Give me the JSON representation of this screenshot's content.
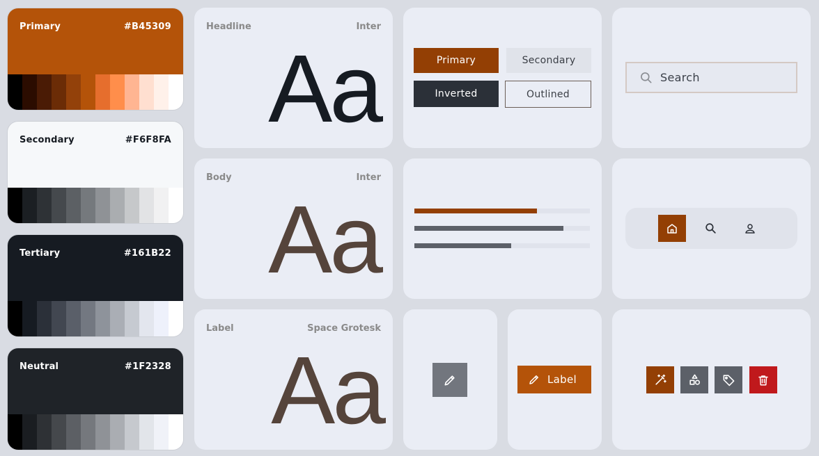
{
  "palette": {
    "primary": {
      "name": "Primary",
      "hex": "#B45309",
      "shades": [
        "#000000",
        "#2b0c00",
        "#4a1b05",
        "#6b2c06",
        "#93410a",
        "#b45309",
        "#e66e2d",
        "#ff8e4b",
        "#ffb592",
        "#ffdfd0",
        "#fff1ea",
        "#ffffff"
      ]
    },
    "secondary": {
      "name": "Secondary",
      "hex": "#F6F8FA",
      "shades": [
        "#000000",
        "#1b1f23",
        "#2e3236",
        "#45494d",
        "#5c6064",
        "#75797d",
        "#8f9296",
        "#aaadb0",
        "#c6c8ca",
        "#e2e3e5",
        "#f1f1f2",
        "#ffffff"
      ]
    },
    "tertiary": {
      "name": "Tertiary",
      "hex": "#161B22",
      "shades": [
        "#000000",
        "#161b22",
        "#2b3039",
        "#424751",
        "#5a5f69",
        "#737881",
        "#8e939b",
        "#aaaeb5",
        "#c6cad1",
        "#e3e6ee",
        "#eef1fb",
        "#ffffff"
      ]
    },
    "neutral": {
      "name": "Neutral",
      "hex": "#1F2328",
      "shades": [
        "#000000",
        "#1a1d21",
        "#2e3135",
        "#45484c",
        "#5c5f64",
        "#75787d",
        "#8f9297",
        "#aaadb2",
        "#c6c9ce",
        "#e2e5ea",
        "#f0f2f8",
        "#ffffff"
      ]
    }
  },
  "typography": {
    "headline": {
      "label": "Headline",
      "font": "Inter",
      "sample": "Aa"
    },
    "body": {
      "label": "Body",
      "font": "Inter",
      "sample": "Aa"
    },
    "label": {
      "label": "Label",
      "font": "Space Grotesk",
      "sample": "Aa"
    }
  },
  "buttons": {
    "primary": "Primary",
    "secondary": "Secondary",
    "inverted": "Inverted",
    "outlined": "Outlined"
  },
  "search": {
    "placeholder": "Search"
  },
  "progress": [
    0.7,
    0.85,
    0.55
  ],
  "nav": {
    "items": [
      "home-icon",
      "search-icon",
      "person-icon"
    ],
    "active": 0
  },
  "fab": {
    "label": "Label",
    "icon": "pencil-icon"
  },
  "icon_buttons": [
    "magic-wand-icon",
    "shapes-icon",
    "tag-icon",
    "trash-icon"
  ],
  "colors": {
    "primary": "#B45309",
    "primary_dark": "#933f04",
    "ink": "#161B22",
    "neutral_btn": "#60646b",
    "danger": "#c0191c",
    "body_text": "#55443b"
  }
}
